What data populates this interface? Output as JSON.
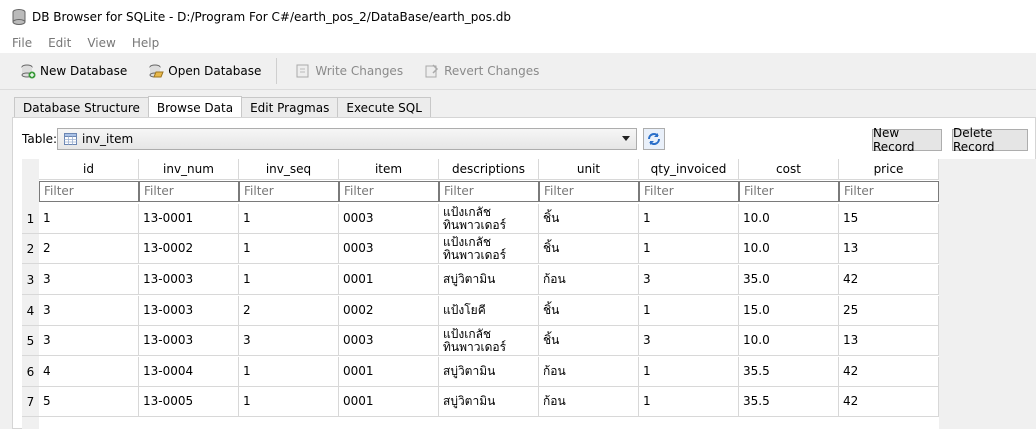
{
  "window": {
    "title": "DB Browser for SQLite - D:/Program For C#/earth_pos_2/DataBase/earth_pos.db"
  },
  "menu": [
    "File",
    "Edit",
    "View",
    "Help"
  ],
  "toolbar": {
    "new_database": "New Database",
    "open_database": "Open Database",
    "write_changes": "Write Changes",
    "revert_changes": "Revert Changes"
  },
  "tabs": [
    "Database Structure",
    "Browse Data",
    "Edit Pragmas",
    "Execute SQL"
  ],
  "browse": {
    "table_label": "Table:",
    "selected_table": "inv_item",
    "new_record": "New Record",
    "delete_record": "Delete Record"
  },
  "grid": {
    "columns": [
      "id",
      "inv_num",
      "inv_seq",
      "item",
      "descriptions",
      "unit",
      "qty_invoiced",
      "cost",
      "price"
    ],
    "filter_placeholder": "Filter",
    "row_numbers": [
      "1",
      "2",
      "3",
      "4",
      "5",
      "6",
      "7"
    ],
    "rows": [
      [
        "1",
        "13-0001",
        "1",
        "0003",
        "แป้งเกลัช\nทินพาวเดอร์",
        "ชิ้น",
        "1",
        "10.0",
        "15"
      ],
      [
        "2",
        "13-0002",
        "1",
        "0003",
        "แป้งเกลัช\nทินพาวเดอร์",
        "ชิ้น",
        "1",
        "10.0",
        "13"
      ],
      [
        "3",
        "13-0003",
        "1",
        "0001",
        "สบู่วิตามิน",
        "ก้อน",
        "3",
        "35.0",
        "42"
      ],
      [
        "3",
        "13-0003",
        "2",
        "0002",
        "แป้งโยคี",
        "ชิ้น",
        "1",
        "15.0",
        "25"
      ],
      [
        "3",
        "13-0003",
        "3",
        "0003",
        "แป้งเกลัช\nทินพาวเดอร์",
        "ชิ้น",
        "3",
        "10.0",
        "13"
      ],
      [
        "4",
        "13-0004",
        "1",
        "0001",
        "สบู่วิตามิน",
        "ก้อน",
        "1",
        "35.5",
        "42"
      ],
      [
        "5",
        "13-0005",
        "1",
        "0001",
        "สบู่วิตามิน",
        "ก้อน",
        "1",
        "35.5",
        "42"
      ]
    ]
  }
}
